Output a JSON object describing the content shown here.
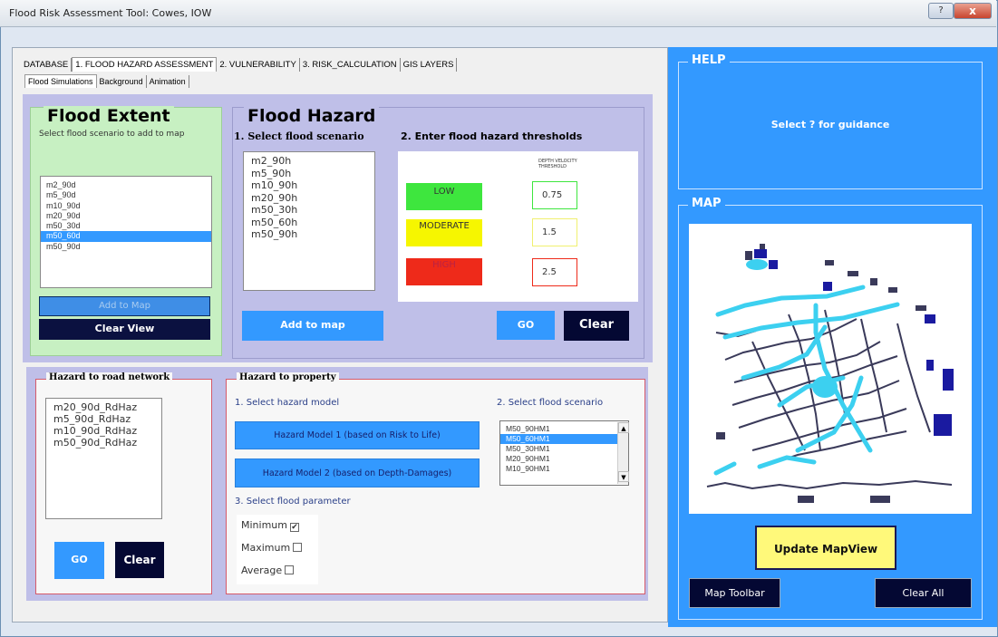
{
  "window": {
    "title": "Flood Risk Assessment Tool: Cowes, IOW",
    "help_glyph": "?",
    "close_glyph": "x"
  },
  "tabs_top": [
    "DATABASE",
    "1. FLOOD HAZARD ASSESSMENT",
    "2. VULNERABILITY",
    "3. RISK_CALCULATION",
    "GIS LAYERS"
  ],
  "tabs_sub": [
    "Flood Simulations",
    "Background",
    "Animation"
  ],
  "flood_extent": {
    "title": "Flood Extent",
    "subtitle": "Select flood scenario to add to map",
    "scenarios": [
      "m2_90d",
      "m5_90d",
      "m10_90d",
      "m20_90d",
      "m50_30d",
      "m50_60d",
      "m50_90d"
    ],
    "selected_index": 5,
    "add_button": "Add to Map",
    "clear_button": "Clear View"
  },
  "flood_hazard": {
    "title": "Flood Hazard",
    "step1": "1. Select flood scenario",
    "step2": "2. Enter flood hazard thresholds",
    "scenarios": [
      "m2_90h",
      "m5_90h",
      "m10_90h",
      "m20_90h",
      "m50_30h",
      "m50_60h",
      "m50_90h"
    ],
    "threshold_header": "DEPTH VELOCITY THRESHOLD",
    "levels": [
      {
        "label": "LOW",
        "value": "0.75",
        "color": "#3ee63e"
      },
      {
        "label": "MODERATE",
        "value": "1.5",
        "color": "#f6f600"
      },
      {
        "label": "HIGH",
        "value": "2.5",
        "color": "#ee2a1a"
      }
    ],
    "add_button": "Add to map",
    "go_button": "GO",
    "clear_button": "Clear"
  },
  "road": {
    "legend": "Hazard to road network",
    "items": [
      "m20_90d_RdHaz",
      "m5_90d_RdHaz",
      "m10_90d_RdHaz",
      "m50_90d_RdHaz"
    ],
    "go_button": "GO",
    "clear_button": "Clear"
  },
  "property": {
    "legend": "Hazard to property",
    "step1": "1. Select hazard model",
    "step2": "2. Select flood scenario",
    "step3": "3. Select flood parameter",
    "model1": "Hazard Model 1 (based on Risk to Life)",
    "model2": "Hazard Model 2 (based on Depth-Damages)",
    "scenarios": [
      "M50_90HM1",
      "M50_60HM1",
      "M50_30HM1",
      "M20_90HM1",
      "M10_90HM1"
    ],
    "selected_index": 1,
    "params": [
      {
        "label": "Minimum",
        "checked": true
      },
      {
        "label": "Maximum",
        "checked": false
      },
      {
        "label": "Average",
        "checked": false
      }
    ]
  },
  "help": {
    "legend": "HELP",
    "text": "Select ? for guidance"
  },
  "map": {
    "legend": "MAP",
    "update_button": "Update MapView",
    "toolbar_button": "Map Toolbar",
    "clear_all_button": "Clear All"
  },
  "colors": {
    "accent_blue": "#3399ff",
    "dark_navy": "#040833",
    "extent_green": "#c7f0c2",
    "hazard_lavender": "#bfbfe8",
    "flood_cyan": "#3cd0f0",
    "building_dark": "#3a3a5a"
  }
}
